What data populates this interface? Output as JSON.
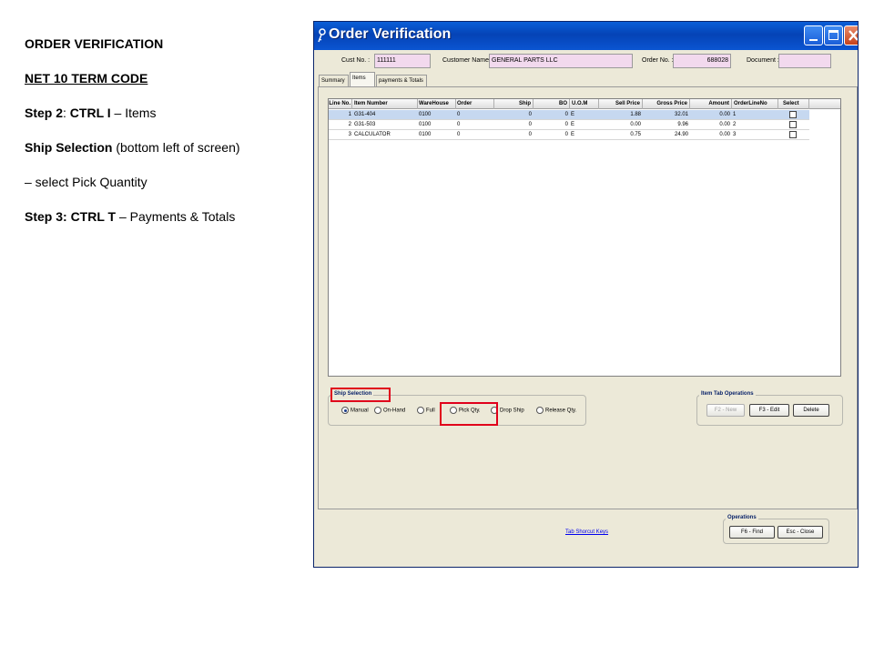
{
  "instructions": {
    "heading": "ORDER VERIFICATION",
    "term_code": "NET 10 TERM CODE",
    "step2_prefix": "Step 2",
    "step2_sep": ":  ",
    "step2_key": "CTRL I",
    "step2_rest": " – Items",
    "ship_sel_label": "Ship Selection",
    "ship_sel_rest": " (bottom left of screen)",
    "pick_line": "– select Pick Quantity",
    "step3_label": "Step 3:  CTRL T",
    "step3_rest": " – Payments & Totals"
  },
  "window": {
    "title": "Order Verification",
    "cust_no_label": "Cust No. :",
    "cust_no": "111111",
    "customer_name_label": "Customer Name :",
    "customer_name": "GENERAL PARTS LLC",
    "order_no_label": "Order No. :",
    "order_no": "688028",
    "document_label": "Document :",
    "document": ""
  },
  "tabs": [
    "Summary",
    "Items",
    "payments & Totals"
  ],
  "grid": {
    "columns": [
      "Line No.",
      "Item Number",
      "WareHouse",
      "Order",
      "Ship",
      "BO",
      "U.O.M",
      "Sell Price",
      "Gross Price",
      "Amount",
      "OrderLineNo",
      "Select"
    ],
    "rows": [
      [
        "1",
        "G31-404",
        "0100",
        "0",
        "0",
        "0",
        "E",
        "1.88",
        "32.01",
        "0.00",
        "1"
      ],
      [
        "2",
        "G31-503",
        "0100",
        "0",
        "0",
        "0",
        "E",
        "0.00",
        "9.96",
        "0.00",
        "2"
      ],
      [
        "3",
        "CALCULATOR",
        "0100",
        "0",
        "0",
        "0",
        "E",
        "0.75",
        "24.90",
        "0.00",
        "3"
      ]
    ]
  },
  "ship_selection": {
    "title": "Ship Selection",
    "options": [
      "Manual",
      "On-Hand",
      "Full",
      "Pick Qty.",
      "Drop Ship",
      "Release Qty."
    ],
    "selected": "Manual"
  },
  "item_tab_ops": {
    "title": "Item Tab Operations",
    "new_label": "F2 - New",
    "edit_label": "F3 - Edit",
    "delete_label": "Delete"
  },
  "tab_shortcut_link": "Tab Shorcut Keys",
  "operations": {
    "title": "Operations",
    "find_label": "F6 - Find",
    "close_label": "Esc - Close"
  },
  "colors": {
    "highlight_red": "#e0001b",
    "field_pink": "#f2d9ee",
    "title_blue": "#0543b6"
  }
}
